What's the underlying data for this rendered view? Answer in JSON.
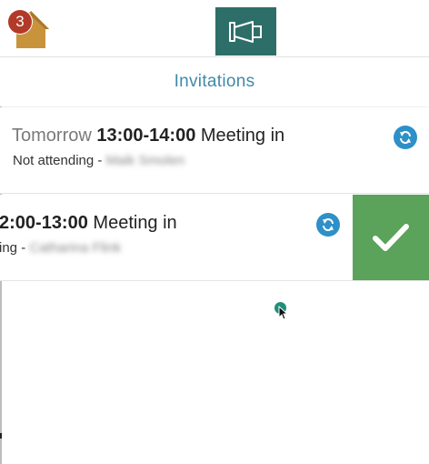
{
  "header": {
    "home_badge_count": "3",
    "colors": {
      "home_icon": "#c9933c",
      "badge": "#b23a28",
      "announce_button": "#2e6e68"
    },
    "announce_icon": "megaphone-icon"
  },
  "tabs": {
    "title": "Invitations",
    "color": "#3f8aa8"
  },
  "invitations": [
    {
      "day": "Tomorrow",
      "time": "13:00-14:00",
      "subject": "Meeting in",
      "status": "Not attending",
      "separator": "-",
      "person": "Maik Smolen",
      "icon": "sync-icon"
    },
    {
      "time": "2:00-13:00",
      "subject": "Meeting in",
      "status": "ing",
      "separator": "-",
      "person": "Catharina Flink",
      "icon": "sync-icon",
      "swipe_action": "checkmark-icon",
      "swipe_action_color": "#5ba25b"
    }
  ]
}
